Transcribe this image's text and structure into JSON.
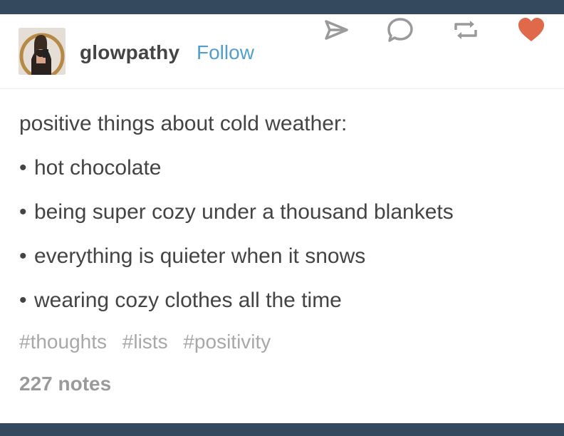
{
  "post": {
    "author": "glowpathy",
    "follow_label": "Follow",
    "intro": "positive things about cold weather:",
    "bullets": [
      "hot chocolate",
      "being super cozy under a thousand blankets",
      "everything is quieter when it snows",
      "wearing cozy clothes all the time"
    ],
    "bullet_char": "•",
    "tags": [
      "#thoughts",
      "#lists",
      "#positivity"
    ],
    "notes": "227 notes"
  },
  "icons": {
    "share": "share-icon",
    "reply": "reply-icon",
    "reblog": "reblog-icon",
    "like": "heart-icon"
  },
  "colors": {
    "background_bar": "#34495e",
    "text": "#444444",
    "follow": "#529ecc",
    "tags": "#a8a8a8",
    "icons": "#9a9a9a",
    "like": "#e0684b"
  }
}
